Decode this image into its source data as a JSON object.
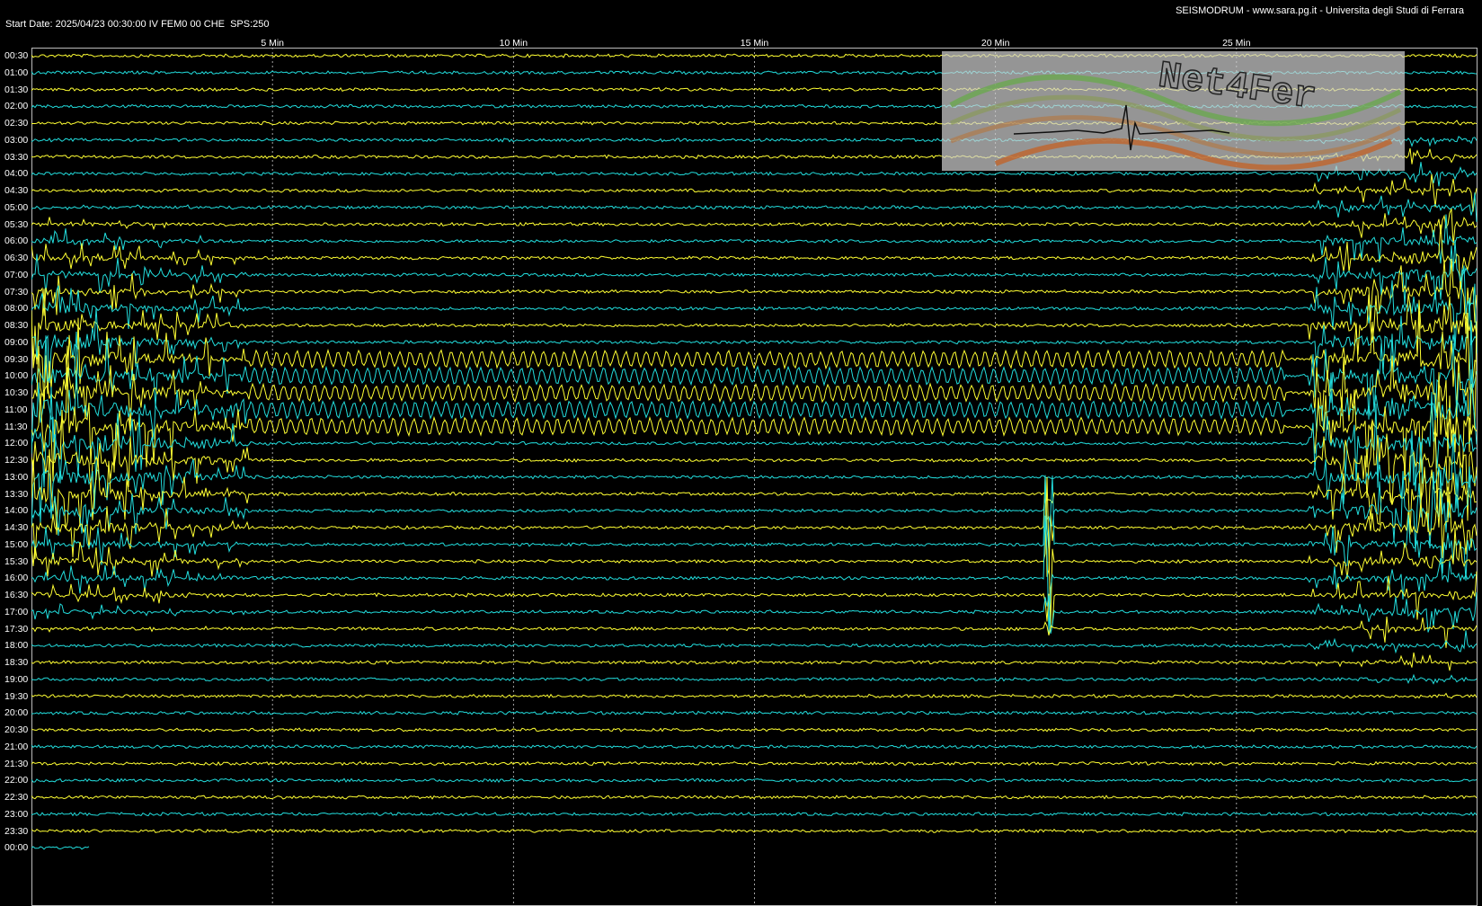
{
  "header": {
    "start_label": "Start Date: 2025/04/23 00:30:00 IV FEM0 00 CHE  SPS:250",
    "source_label": "SEISMODRUM - www.sara.pg.it - Universita degli Studi di Ferrara"
  },
  "logo": {
    "text": "Net4Fer"
  },
  "colors": {
    "background": "#000000",
    "trace_yellow": "#ffff33",
    "trace_cyan": "#22dddd",
    "grid": "#cccccc",
    "text": "#ffffff"
  },
  "chart_data": {
    "type": "line",
    "chart_kind": "helicorder",
    "x_unit_label": "Min",
    "x_ticks": [
      "5 Min",
      "10 Min",
      "15 Min",
      "20 Min",
      "25 Min"
    ],
    "x_tick_values": [
      5,
      10,
      15,
      20,
      25
    ],
    "xlim": [
      0,
      30
    ],
    "row_labels": [
      "00:30",
      "01:00",
      "01:30",
      "02:00",
      "02:30",
      "03:00",
      "03:30",
      "04:00",
      "04:30",
      "05:00",
      "05:30",
      "06:00",
      "06:30",
      "07:00",
      "07:30",
      "08:00",
      "08:30",
      "09:00",
      "09:30",
      "10:00",
      "10:30",
      "11:00",
      "11:30",
      "12:00",
      "12:30",
      "13:00",
      "13:30",
      "14:00",
      "14:30",
      "15:00",
      "15:30",
      "16:00",
      "16:30",
      "17:00",
      "17:30",
      "18:00",
      "18:30",
      "19:00",
      "19:30",
      "20:00",
      "20:30",
      "21:00",
      "21:30",
      "22:00",
      "22:30",
      "23:00",
      "23:30",
      "00:00"
    ],
    "row_color_pattern": [
      "yellow",
      "cyan"
    ],
    "last_row_extent_min": 1.2,
    "grid": "dashed vertical",
    "events": [
      {
        "name": "early-burst",
        "rows": [
          9,
          34
        ],
        "start_min": 0,
        "end_min": 4.5,
        "amplitude": 0.9,
        "color": "cyan"
      },
      {
        "name": "persistent-oscillation",
        "rows": [
          18,
          22
        ],
        "start_min": 4.5,
        "end_min": 26,
        "amplitude": 0.6,
        "color": "mixed"
      },
      {
        "name": "mid-spike",
        "rows": [
          26,
          34
        ],
        "start_min": 21.0,
        "end_min": 21.2,
        "amplitude": 1.0,
        "color": "yellow"
      },
      {
        "name": "late-burst",
        "rows": [
          4,
          38
        ],
        "start_min": 26.5,
        "end_min": 30,
        "amplitude": 1.0,
        "color": "yellow"
      }
    ]
  }
}
